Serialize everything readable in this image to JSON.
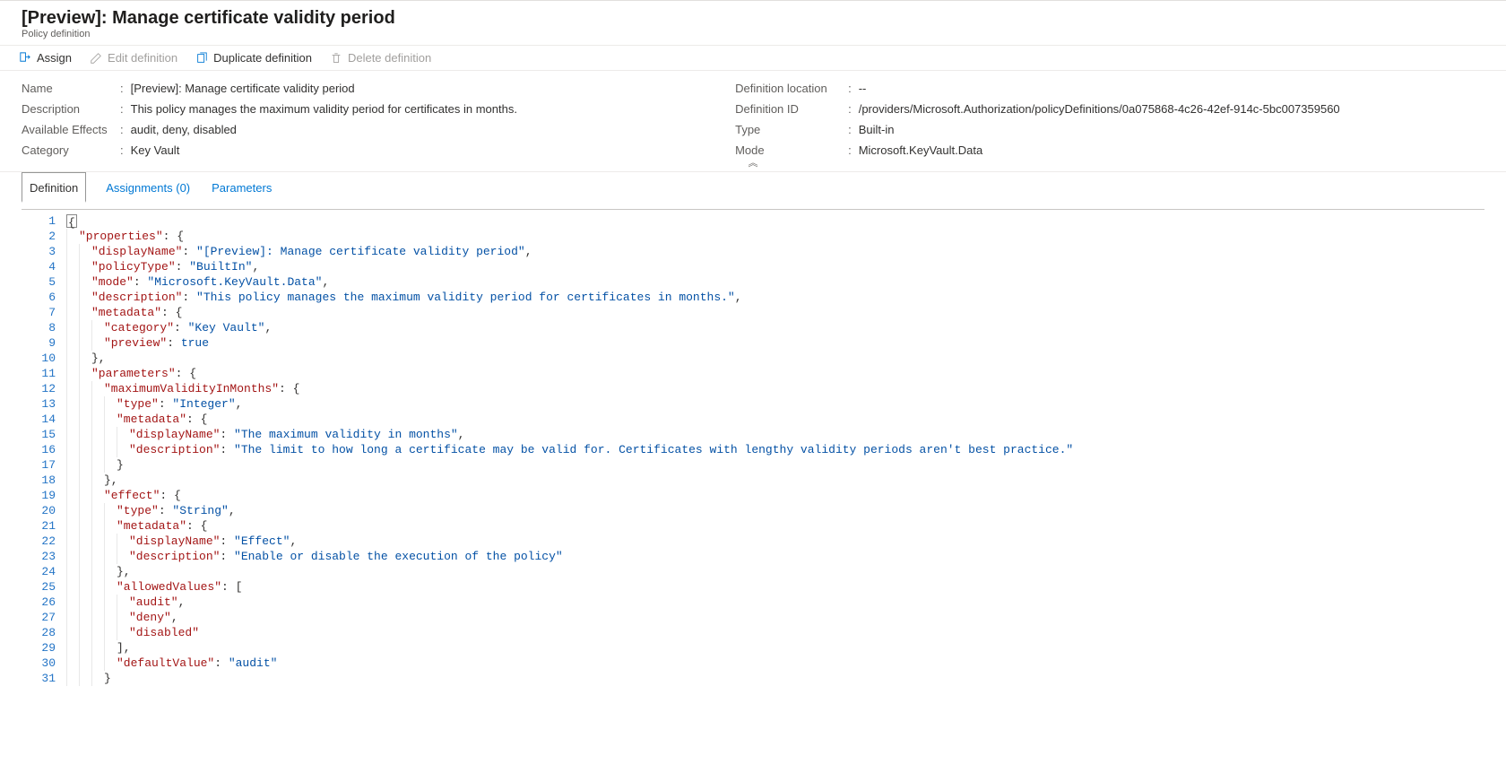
{
  "header": {
    "title": "[Preview]: Manage certificate validity period",
    "subtitle": "Policy definition"
  },
  "toolbar": {
    "assign": "Assign",
    "edit": "Edit definition",
    "duplicate": "Duplicate definition",
    "delete": "Delete definition"
  },
  "details": {
    "left": {
      "name_label": "Name",
      "name_value": "[Preview]: Manage certificate validity period",
      "description_label": "Description",
      "description_value": "This policy manages the maximum validity period for certificates in months.",
      "effects_label": "Available Effects",
      "effects_value": "audit, deny, disabled",
      "category_label": "Category",
      "category_value": "Key Vault"
    },
    "right": {
      "location_label": "Definition location",
      "location_value": "--",
      "id_label": "Definition ID",
      "id_value": "/providers/Microsoft.Authorization/policyDefinitions/0a075868-4c26-42ef-914c-5bc007359560",
      "type_label": "Type",
      "type_value": "Built-in",
      "mode_label": "Mode",
      "mode_value": "Microsoft.KeyVault.Data"
    }
  },
  "tabs": {
    "definition": "Definition",
    "assignments": "Assignments (0)",
    "parameters": "Parameters"
  },
  "code_lines": [
    {
      "n": 1,
      "ig": 0,
      "segs": [
        {
          "c": "tok-plain",
          "html_cursor": true
        }
      ]
    },
    {
      "n": 2,
      "ig": 1,
      "segs": [
        {
          "c": "tok-key",
          "t": "\"properties\""
        },
        {
          "c": "tok-plain",
          "t": ": {"
        }
      ]
    },
    {
      "n": 3,
      "ig": 2,
      "segs": [
        {
          "c": "tok-key",
          "t": "\"displayName\""
        },
        {
          "c": "tok-plain",
          "t": ": "
        },
        {
          "c": "tok-str",
          "t": "\"[Preview]: Manage certificate validity period\""
        },
        {
          "c": "tok-plain",
          "t": ","
        }
      ]
    },
    {
      "n": 4,
      "ig": 2,
      "segs": [
        {
          "c": "tok-key",
          "t": "\"policyType\""
        },
        {
          "c": "tok-plain",
          "t": ": "
        },
        {
          "c": "tok-str",
          "t": "\"BuiltIn\""
        },
        {
          "c": "tok-plain",
          "t": ","
        }
      ]
    },
    {
      "n": 5,
      "ig": 2,
      "segs": [
        {
          "c": "tok-key",
          "t": "\"mode\""
        },
        {
          "c": "tok-plain",
          "t": ": "
        },
        {
          "c": "tok-str",
          "t": "\"Microsoft.KeyVault.Data\""
        },
        {
          "c": "tok-plain",
          "t": ","
        }
      ]
    },
    {
      "n": 6,
      "ig": 2,
      "segs": [
        {
          "c": "tok-key",
          "t": "\"description\""
        },
        {
          "c": "tok-plain",
          "t": ": "
        },
        {
          "c": "tok-str",
          "t": "\"This policy manages the maximum validity period for certificates in months.\""
        },
        {
          "c": "tok-plain",
          "t": ","
        }
      ]
    },
    {
      "n": 7,
      "ig": 2,
      "segs": [
        {
          "c": "tok-key",
          "t": "\"metadata\""
        },
        {
          "c": "tok-plain",
          "t": ": {"
        }
      ]
    },
    {
      "n": 8,
      "ig": 3,
      "segs": [
        {
          "c": "tok-key",
          "t": "\"category\""
        },
        {
          "c": "tok-plain",
          "t": ": "
        },
        {
          "c": "tok-str",
          "t": "\"Key Vault\""
        },
        {
          "c": "tok-plain",
          "t": ","
        }
      ]
    },
    {
      "n": 9,
      "ig": 3,
      "segs": [
        {
          "c": "tok-key",
          "t": "\"preview\""
        },
        {
          "c": "tok-plain",
          "t": ": "
        },
        {
          "c": "tok-lit",
          "t": "true"
        }
      ]
    },
    {
      "n": 10,
      "ig": 2,
      "segs": [
        {
          "c": "tok-plain",
          "t": "},"
        }
      ]
    },
    {
      "n": 11,
      "ig": 2,
      "segs": [
        {
          "c": "tok-key",
          "t": "\"parameters\""
        },
        {
          "c": "tok-plain",
          "t": ": {"
        }
      ]
    },
    {
      "n": 12,
      "ig": 3,
      "segs": [
        {
          "c": "tok-key",
          "t": "\"maximumValidityInMonths\""
        },
        {
          "c": "tok-plain",
          "t": ": {"
        }
      ]
    },
    {
      "n": 13,
      "ig": 4,
      "segs": [
        {
          "c": "tok-key",
          "t": "\"type\""
        },
        {
          "c": "tok-plain",
          "t": ": "
        },
        {
          "c": "tok-str",
          "t": "\"Integer\""
        },
        {
          "c": "tok-plain",
          "t": ","
        }
      ]
    },
    {
      "n": 14,
      "ig": 4,
      "segs": [
        {
          "c": "tok-key",
          "t": "\"metadata\""
        },
        {
          "c": "tok-plain",
          "t": ": {"
        }
      ]
    },
    {
      "n": 15,
      "ig": 5,
      "segs": [
        {
          "c": "tok-key",
          "t": "\"displayName\""
        },
        {
          "c": "tok-plain",
          "t": ": "
        },
        {
          "c": "tok-str",
          "t": "\"The maximum validity in months\""
        },
        {
          "c": "tok-plain",
          "t": ","
        }
      ]
    },
    {
      "n": 16,
      "ig": 5,
      "segs": [
        {
          "c": "tok-key",
          "t": "\"description\""
        },
        {
          "c": "tok-plain",
          "t": ": "
        },
        {
          "c": "tok-str",
          "t": "\"The limit to how long a certificate may be valid for. Certificates with lengthy validity periods aren't best practice.\""
        }
      ]
    },
    {
      "n": 17,
      "ig": 4,
      "segs": [
        {
          "c": "tok-plain",
          "t": "}"
        }
      ]
    },
    {
      "n": 18,
      "ig": 3,
      "segs": [
        {
          "c": "tok-plain",
          "t": "},"
        }
      ]
    },
    {
      "n": 19,
      "ig": 3,
      "segs": [
        {
          "c": "tok-key",
          "t": "\"effect\""
        },
        {
          "c": "tok-plain",
          "t": ": {"
        }
      ]
    },
    {
      "n": 20,
      "ig": 4,
      "segs": [
        {
          "c": "tok-key",
          "t": "\"type\""
        },
        {
          "c": "tok-plain",
          "t": ": "
        },
        {
          "c": "tok-str",
          "t": "\"String\""
        },
        {
          "c": "tok-plain",
          "t": ","
        }
      ]
    },
    {
      "n": 21,
      "ig": 4,
      "segs": [
        {
          "c": "tok-key",
          "t": "\"metadata\""
        },
        {
          "c": "tok-plain",
          "t": ": {"
        }
      ]
    },
    {
      "n": 22,
      "ig": 5,
      "segs": [
        {
          "c": "tok-key",
          "t": "\"displayName\""
        },
        {
          "c": "tok-plain",
          "t": ": "
        },
        {
          "c": "tok-str",
          "t": "\"Effect\""
        },
        {
          "c": "tok-plain",
          "t": ","
        }
      ]
    },
    {
      "n": 23,
      "ig": 5,
      "segs": [
        {
          "c": "tok-key",
          "t": "\"description\""
        },
        {
          "c": "tok-plain",
          "t": ": "
        },
        {
          "c": "tok-str",
          "t": "\"Enable or disable the execution of the policy\""
        }
      ]
    },
    {
      "n": 24,
      "ig": 4,
      "segs": [
        {
          "c": "tok-plain",
          "t": "},"
        }
      ]
    },
    {
      "n": 25,
      "ig": 4,
      "segs": [
        {
          "c": "tok-key",
          "t": "\"allowedValues\""
        },
        {
          "c": "tok-plain",
          "t": ": ["
        }
      ]
    },
    {
      "n": 26,
      "ig": 5,
      "segs": [
        {
          "c": "tok-key",
          "t": "\"audit\""
        },
        {
          "c": "tok-plain",
          "t": ","
        }
      ]
    },
    {
      "n": 27,
      "ig": 5,
      "segs": [
        {
          "c": "tok-key",
          "t": "\"deny\""
        },
        {
          "c": "tok-plain",
          "t": ","
        }
      ]
    },
    {
      "n": 28,
      "ig": 5,
      "segs": [
        {
          "c": "tok-key",
          "t": "\"disabled\""
        }
      ]
    },
    {
      "n": 29,
      "ig": 4,
      "segs": [
        {
          "c": "tok-plain",
          "t": "],"
        }
      ]
    },
    {
      "n": 30,
      "ig": 4,
      "segs": [
        {
          "c": "tok-key",
          "t": "\"defaultValue\""
        },
        {
          "c": "tok-plain",
          "t": ": "
        },
        {
          "c": "tok-str",
          "t": "\"audit\""
        }
      ]
    },
    {
      "n": 31,
      "ig": 3,
      "segs": [
        {
          "c": "tok-plain",
          "t": "}"
        }
      ]
    }
  ]
}
